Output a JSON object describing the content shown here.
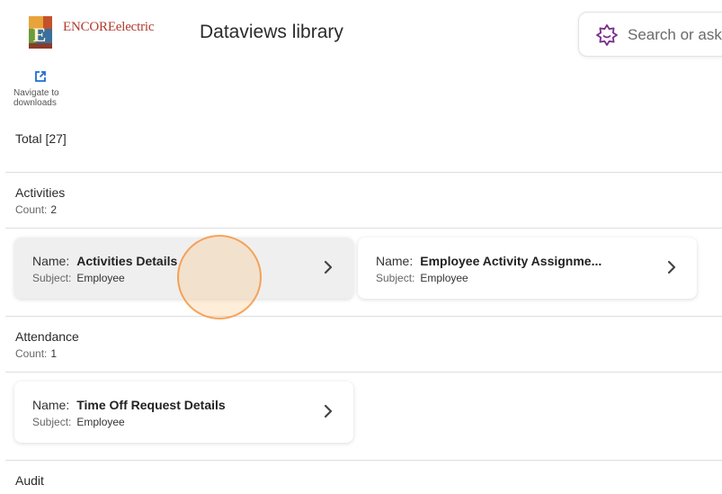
{
  "header": {
    "logo_text": "ENCOREelectric",
    "logo_mark_letter": "E",
    "title": "Dataviews library",
    "search": {
      "placeholder": "Search or ask",
      "value": ""
    }
  },
  "navigate_downloads": {
    "line1": "Navigate to",
    "line2": "downloads",
    "icon": "external-link-icon"
  },
  "total_label": "Total [27]",
  "count_label": "Count:",
  "name_key": "Name:",
  "subject_key": "Subject:",
  "sections": [
    {
      "title": "Activities",
      "count": "2",
      "cards": [
        {
          "name": "Activities Details",
          "subject": "Employee"
        },
        {
          "name": "Employee Activity Assignme...",
          "subject": "Employee"
        }
      ]
    },
    {
      "title": "Attendance",
      "count": "1",
      "cards": [
        {
          "name": "Time Off Request Details",
          "subject": "Employee"
        }
      ]
    },
    {
      "title": "Audit",
      "count": "",
      "cards": []
    }
  ],
  "colors": {
    "accent": "#7b2e8e",
    "logo_red": "#b03a2e",
    "click_ring": "#f58c32"
  }
}
